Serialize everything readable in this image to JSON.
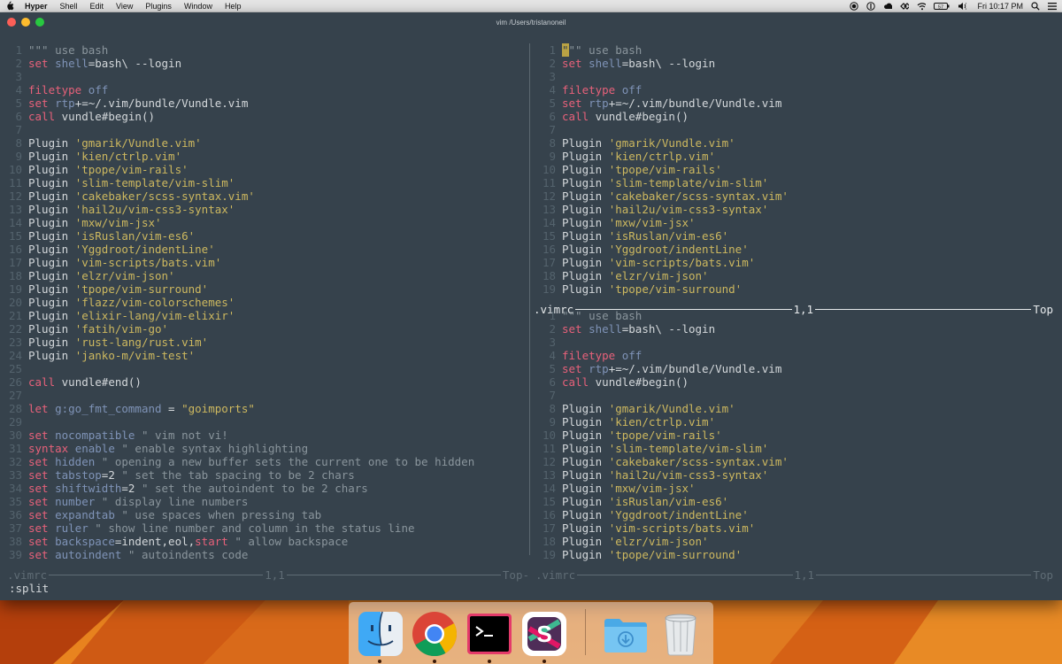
{
  "menubar": {
    "app_name": "Hyper",
    "items": [
      "Shell",
      "Edit",
      "View",
      "Plugins",
      "Window",
      "Help"
    ],
    "clock": "Fri 10:17 PM",
    "battery_percent": "57"
  },
  "window": {
    "title": "vim /Users/tristanoneil"
  },
  "vimrc": [
    [
      [
        "com",
        "\"\"\" use bash"
      ]
    ],
    [
      [
        "kw",
        "set "
      ],
      [
        "opt",
        "shell"
      ],
      [
        "plain",
        "=bash\\ --login"
      ]
    ],
    [],
    [
      [
        "kw",
        "filetype "
      ],
      [
        "opt",
        "off"
      ]
    ],
    [
      [
        "kw",
        "set "
      ],
      [
        "opt",
        "rtp"
      ],
      [
        "plain",
        "+=~/.vim/bundle/Vundle.vim"
      ]
    ],
    [
      [
        "kw",
        "call "
      ],
      [
        "plain",
        "vundle#begin()"
      ]
    ],
    [],
    [
      [
        "plain",
        "Plugin "
      ],
      [
        "str",
        "'gmarik/Vundle.vim'"
      ]
    ],
    [
      [
        "plain",
        "Plugin "
      ],
      [
        "str",
        "'kien/ctrlp.vim'"
      ]
    ],
    [
      [
        "plain",
        "Plugin "
      ],
      [
        "str",
        "'tpope/vim-rails'"
      ]
    ],
    [
      [
        "plain",
        "Plugin "
      ],
      [
        "str",
        "'slim-template/vim-slim'"
      ]
    ],
    [
      [
        "plain",
        "Plugin "
      ],
      [
        "str",
        "'cakebaker/scss-syntax.vim'"
      ]
    ],
    [
      [
        "plain",
        "Plugin "
      ],
      [
        "str",
        "'hail2u/vim-css3-syntax'"
      ]
    ],
    [
      [
        "plain",
        "Plugin "
      ],
      [
        "str",
        "'mxw/vim-jsx'"
      ]
    ],
    [
      [
        "plain",
        "Plugin "
      ],
      [
        "str",
        "'isRuslan/vim-es6'"
      ]
    ],
    [
      [
        "plain",
        "Plugin "
      ],
      [
        "str",
        "'Yggdroot/indentLine'"
      ]
    ],
    [
      [
        "plain",
        "Plugin "
      ],
      [
        "str",
        "'vim-scripts/bats.vim'"
      ]
    ],
    [
      [
        "plain",
        "Plugin "
      ],
      [
        "str",
        "'elzr/vim-json'"
      ]
    ],
    [
      [
        "plain",
        "Plugin "
      ],
      [
        "str",
        "'tpope/vim-surround'"
      ]
    ],
    [
      [
        "plain",
        "Plugin "
      ],
      [
        "str",
        "'flazz/vim-colorschemes'"
      ]
    ],
    [
      [
        "plain",
        "Plugin "
      ],
      [
        "str",
        "'elixir-lang/vim-elixir'"
      ]
    ],
    [
      [
        "plain",
        "Plugin "
      ],
      [
        "str",
        "'fatih/vim-go'"
      ]
    ],
    [
      [
        "plain",
        "Plugin "
      ],
      [
        "str",
        "'rust-lang/rust.vim'"
      ]
    ],
    [
      [
        "plain",
        "Plugin "
      ],
      [
        "str",
        "'janko-m/vim-test'"
      ]
    ],
    [],
    [
      [
        "kw",
        "call "
      ],
      [
        "plain",
        "vundle#end()"
      ]
    ],
    [],
    [
      [
        "kw",
        "let "
      ],
      [
        "opt",
        "g:go_fmt_command"
      ],
      [
        "plain",
        " = "
      ],
      [
        "str",
        "\"goimports\""
      ]
    ],
    [],
    [
      [
        "kw",
        "set "
      ],
      [
        "opt",
        "nocompatible "
      ],
      [
        "com",
        "\" vim not vi!"
      ]
    ],
    [
      [
        "kw",
        "syntax "
      ],
      [
        "opt",
        "enable "
      ],
      [
        "com",
        "\" enable syntax highlighting"
      ]
    ],
    [
      [
        "kw",
        "set "
      ],
      [
        "opt",
        "hidden "
      ],
      [
        "com",
        "\" opening a new buffer sets the current one to be hidden"
      ]
    ],
    [
      [
        "kw",
        "set "
      ],
      [
        "opt",
        "tabstop"
      ],
      [
        "plain",
        "=2 "
      ],
      [
        "com",
        "\" set the tab spacing to be 2 chars"
      ]
    ],
    [
      [
        "kw",
        "set "
      ],
      [
        "opt",
        "shiftwidth"
      ],
      [
        "plain",
        "=2 "
      ],
      [
        "com",
        "\" set the autoindent to be 2 chars"
      ]
    ],
    [
      [
        "kw",
        "set "
      ],
      [
        "opt",
        "number "
      ],
      [
        "com",
        "\" display line numbers"
      ]
    ],
    [
      [
        "kw",
        "set "
      ],
      [
        "opt",
        "expandtab "
      ],
      [
        "com",
        "\" use spaces when pressing tab"
      ]
    ],
    [
      [
        "kw",
        "set "
      ],
      [
        "opt",
        "ruler "
      ],
      [
        "com",
        "\" show line number and column in the status line"
      ]
    ],
    [
      [
        "kw",
        "set "
      ],
      [
        "opt",
        "backspace"
      ],
      [
        "plain",
        "=indent,eol,"
      ],
      [
        "kw",
        "start "
      ],
      [
        "com",
        "\" allow backspace"
      ]
    ],
    [
      [
        "kw",
        "set "
      ],
      [
        "opt",
        "autoindent "
      ],
      [
        "com",
        "\" autoindents code"
      ]
    ]
  ],
  "panes": {
    "left_visible_lines": 39,
    "right_top_visible_lines": 19,
    "right_bottom_visible_lines": 19
  },
  "status": {
    "active": {
      "file": ".vimrc",
      "position": "1,1",
      "scroll": "Top"
    },
    "inactive_left": {
      "file": ".vimrc",
      "position": "1,1",
      "scroll": "Top-"
    },
    "inactive_right": {
      "file": ".vimrc",
      "position": "1,1",
      "scroll": "Top"
    }
  },
  "command_line": ":split",
  "colors": {
    "terminal_bg": "#36424c",
    "keyword": "#e7617a",
    "option": "#7f93b7",
    "string": "#cdb85f",
    "comment": "#8a959c",
    "line_number": "#54636d"
  },
  "dock": {
    "apps": [
      {
        "name": "finder-icon",
        "running": true
      },
      {
        "name": "chrome-icon",
        "running": true
      },
      {
        "name": "hyper-terminal-icon",
        "running": true
      },
      {
        "name": "slack-icon",
        "running": true
      },
      {
        "name": "downloads-folder-icon",
        "running": false
      },
      {
        "name": "trash-icon",
        "running": false
      }
    ]
  }
}
